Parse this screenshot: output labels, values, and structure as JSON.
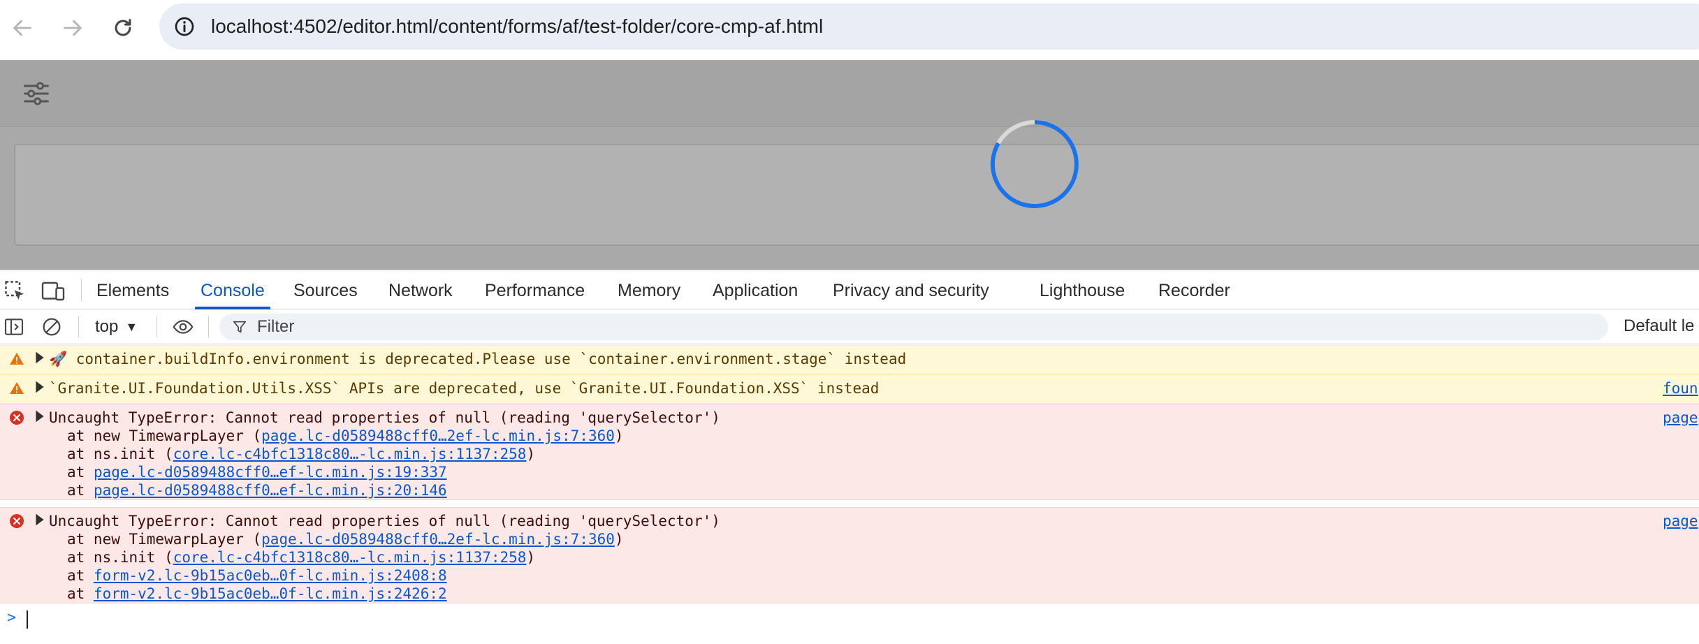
{
  "browser": {
    "url": "localhost:4502/editor.html/content/forms/af/test-folder/core-cmp-af.html",
    "icons": [
      "back-arrow-icon",
      "forward-arrow-icon",
      "reload-icon",
      "site-info-icon"
    ]
  },
  "page": {
    "toolbar_icon": "settings-sliders-icon",
    "loading": true
  },
  "devtools": {
    "tabs": [
      {
        "label": "Elements",
        "active": false
      },
      {
        "label": "Console",
        "active": true
      },
      {
        "label": "Sources",
        "active": false
      },
      {
        "label": "Network",
        "active": false
      },
      {
        "label": "Performance",
        "active": false
      },
      {
        "label": "Memory",
        "active": false
      },
      {
        "label": "Application",
        "active": false
      },
      {
        "label": "Privacy and security",
        "active": false
      },
      {
        "label": "Lighthouse",
        "active": false
      },
      {
        "label": "Recorder",
        "active": false
      }
    ],
    "toolbar": {
      "context": "top",
      "filter_placeholder": "Filter",
      "levels_label": "Default le"
    },
    "messages": [
      {
        "level": "warning",
        "text": "🚀 container.buildInfo.environment is deprecated.Please use `container.environment.stage` instead",
        "source": ""
      },
      {
        "level": "warning",
        "text": "`Granite.UI.Foundation.Utils.XSS` APIs are deprecated, use `Granite.UI.Foundation.XSS` instead",
        "source": "foun"
      },
      {
        "level": "error",
        "text": "Uncaught TypeError: Cannot read properties of null (reading 'querySelector')",
        "source": "page",
        "stack": [
          {
            "prefix": "at new TimewarpLayer (",
            "link": "page.lc-d0589488cff0…2ef-lc.min.js:7:360",
            "suffix": ")"
          },
          {
            "prefix": "at ns.init (",
            "link": "core.lc-c4bfc1318c80…-lc.min.js:1137:258",
            "suffix": ")"
          },
          {
            "prefix": "at ",
            "link": "page.lc-d0589488cff0…ef-lc.min.js:19:337",
            "suffix": ""
          },
          {
            "prefix": "at ",
            "link": "page.lc-d0589488cff0…ef-lc.min.js:20:146",
            "suffix": ""
          }
        ]
      },
      {
        "level": "error",
        "text": "Uncaught TypeError: Cannot read properties of null (reading 'querySelector')",
        "source": "page",
        "stack": [
          {
            "prefix": "at new TimewarpLayer (",
            "link": "page.lc-d0589488cff0…2ef-lc.min.js:7:360",
            "suffix": ")"
          },
          {
            "prefix": "at ns.init (",
            "link": "core.lc-c4bfc1318c80…-lc.min.js:1137:258",
            "suffix": ")"
          },
          {
            "prefix": "at ",
            "link": "form-v2.lc-9b15ac0eb…0f-lc.min.js:2408:8",
            "suffix": ""
          },
          {
            "prefix": "at ",
            "link": "form-v2.lc-9b15ac0eb…0f-lc.min.js:2426:2",
            "suffix": ""
          }
        ]
      }
    ],
    "prompt_symbol": ">"
  },
  "colors": {
    "accent": "#0b57d0",
    "spinner": "#1a73e8",
    "warning_bg": "#fff8d6",
    "error_bg": "#fce8e6",
    "warning_icon": "#e8710a",
    "error_icon": "#d93025"
  }
}
